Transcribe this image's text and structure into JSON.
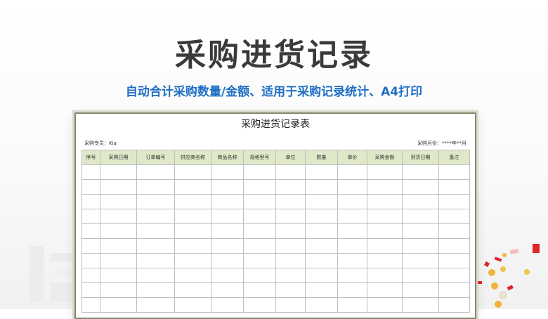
{
  "header": {
    "title": "采购进货记录",
    "subtitle": "自动合计采购数量/金额、适用于采购记录统计、A4打印"
  },
  "sheet": {
    "title": "采购进货记录表",
    "buyer_label": "采购专员：Kia",
    "month_label": "采购月份：****年**月",
    "columns": [
      "序号",
      "采购日期",
      "订单编号",
      "供应商名称",
      "商品名称",
      "规格型号",
      "单位",
      "数量",
      "单价",
      "采购金额",
      "到货日期",
      "备注"
    ],
    "empty_row_count": 10
  },
  "colors": {
    "title": "#3a3a3a",
    "subtitle": "#1f6fc4",
    "header_fill": "#dfe8c8",
    "sheet_border": "#7f8a6e"
  }
}
